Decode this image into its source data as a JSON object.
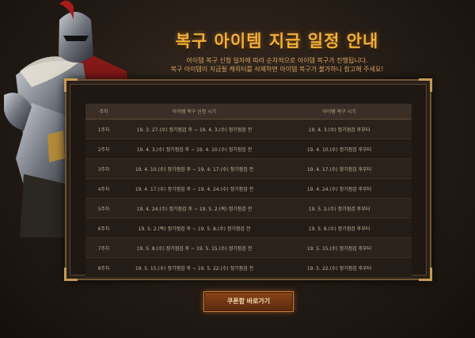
{
  "header": {
    "title": "복구 아이템 지급 일정 안내",
    "subtitle_line1": "아이템 복구 신청 일자에 따라 순차적으로 아이템 복구가 진행됩니다.",
    "subtitle_line2": "복구 아이템이 지급될 캐릭터를 삭제하면 아이템 복구가 불가하니 참고해 주세요!"
  },
  "table": {
    "columns": [
      "주차",
      "아이템 복구 신청 시기",
      "아이템 복구 시기"
    ],
    "rows": [
      {
        "week": "1주차",
        "apply": "19. 3. 27.(수) 정기점검 후 ~ 19. 4. 3.(수) 정기점검 전",
        "restore": "19. 4. 3.(수) 정기점검 후부터"
      },
      {
        "week": "2주차",
        "apply": "19. 4. 3.(수) 정기점검 후 ~ 19. 4. 10.(수) 정기점검 전",
        "restore": "19. 4. 10.(수) 정기점검 후부터"
      },
      {
        "week": "3주차",
        "apply": "19. 4. 10.(수) 정기점검 후 ~ 19. 4. 17.(수) 정기점검 전",
        "restore": "19. 4. 17.(수) 정기점검 후부터"
      },
      {
        "week": "4주차",
        "apply": "19. 4. 17.(수) 정기점검 후 ~ 19. 4. 24.(수) 정기점검 전",
        "restore": "19. 4. 24.(수) 정기점검 후부터"
      },
      {
        "week": "5주차",
        "apply": "19. 4. 24.(수) 정기점검 후 ~ 19. 5. 2.(목) 정기점검 전",
        "restore": "19. 5. 2.(수) 정기점검 후부터"
      },
      {
        "week": "6주차",
        "apply": "19. 5. 2.(목) 정기점검 후 ~ 19. 5. 8.(수) 정기점검 전",
        "restore": "19. 5. 8.(수) 정기점검 후부터"
      },
      {
        "week": "7주차",
        "apply": "19. 5. 8.(수) 정기점검 후 ~ 19. 5. 15.(수) 정기점검 전",
        "restore": "19. 5. 15.(수) 정기점검 후부터"
      },
      {
        "week": "8주차",
        "apply": "19. 5. 15.(수) 정기점검 후 ~ 19. 5. 22.(수) 정기점검 전",
        "restore": "19. 5. 22.(수) 정기점검 후부터"
      }
    ]
  },
  "cta": {
    "label": "쿠폰함 바로가기"
  },
  "colors": {
    "title": "#f0b03a",
    "frame": "#6e5535",
    "button": "#8a4418"
  }
}
